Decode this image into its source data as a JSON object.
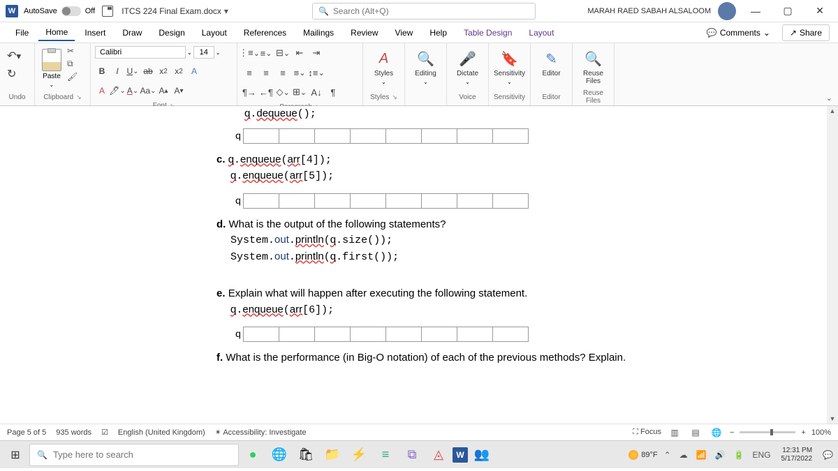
{
  "title_bar": {
    "autosave_label": "AutoSave",
    "autosave_state": "Off",
    "doc_name": "ITCS 224 Final Exam.docx",
    "search_placeholder": "Search (Alt+Q)",
    "user_name": "MARAH RAED SABAH ALSALOOM"
  },
  "menu": {
    "items": [
      "File",
      "Home",
      "Insert",
      "Draw",
      "Design",
      "Layout",
      "References",
      "Mailings",
      "Review",
      "View",
      "Help",
      "Table Design",
      "Layout"
    ],
    "active": "Home",
    "comments": "Comments",
    "share": "Share"
  },
  "ribbon": {
    "undo_label": "Undo",
    "clipboard_label": "Clipboard",
    "paste": "Paste",
    "font_label": "Font",
    "font_name": "Calibri",
    "font_size": "14",
    "paragraph_label": "Paragraph",
    "styles_label": "Styles",
    "styles_btn": "Styles",
    "editing_btn": "Editing",
    "voice_label": "Voice",
    "dictate": "Dictate",
    "sensitivity_label": "Sensitivity",
    "sensitivity_btn": "Sensitivity",
    "editor_label": "Editor",
    "editor_btn": "Editor",
    "reuse_label": "Reuse Files",
    "reuse_btn": "Reuse Files"
  },
  "document": {
    "line_deq": "q.dequeue();",
    "q_label": "q",
    "item_c_label": "c.",
    "item_c_line1": "q.enqueue(arr[4]);",
    "item_c_line2": "q.enqueue(arr[5]);",
    "item_d_label": "d.",
    "item_d_text": "What is the output of the following statements?",
    "item_d_line1": "System.out.println(q.size());",
    "item_d_line2": "System.out.println(q.first());",
    "item_e_label": "e.",
    "item_e_text": "Explain what will happen after executing the following statement.",
    "item_e_line1": "q.enqueue(arr[6]);",
    "item_f_label": "f.",
    "item_f_text": "What is the performance (in Big-O notation) of each of the previous methods? Explain."
  },
  "status": {
    "page": "Page 5 of 5",
    "words": "935 words",
    "lang": "English (United Kingdom)",
    "accessibility": "Accessibility: Investigate",
    "focus": "Focus",
    "zoom": "100%"
  },
  "taskbar": {
    "search_placeholder": "Type here to search",
    "temp": "89°F",
    "lang": "ENG",
    "time": "12:31 PM",
    "date": "5/17/2022"
  }
}
